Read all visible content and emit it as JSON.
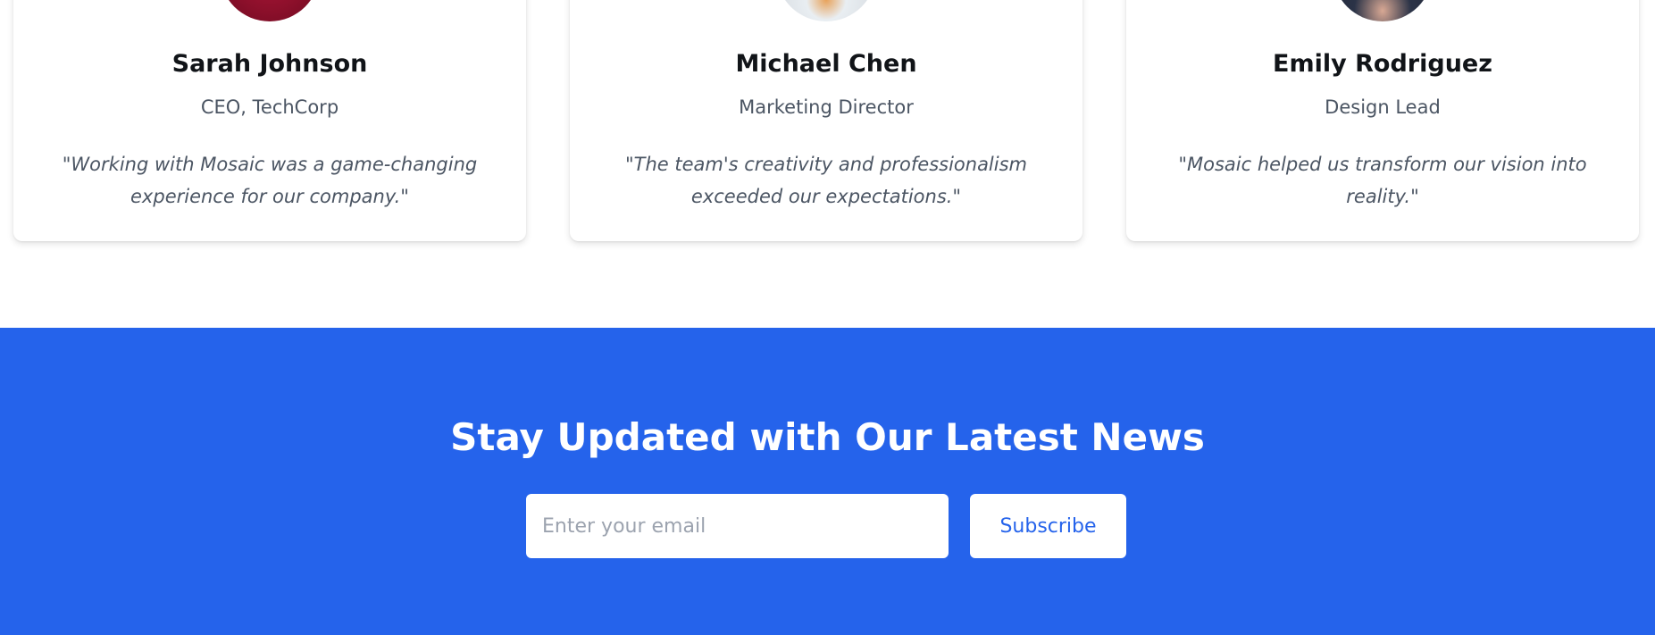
{
  "testimonials": [
    {
      "name": "Sarah Johnson",
      "role": "CEO, TechCorp",
      "quote": "\"Working with Mosaic was a game-changing experience for our company.\""
    },
    {
      "name": "Michael Chen",
      "role": "Marketing Director",
      "quote": "\"The team's creativity and professionalism exceeded our expectations.\""
    },
    {
      "name": "Emily Rodriguez",
      "role": "Design Lead",
      "quote": "\"Mosaic helped us transform our vision into reality.\""
    }
  ],
  "newsletter": {
    "title": "Stay Updated with Our Latest News",
    "email_placeholder": "Enter your email",
    "email_value": "",
    "subscribe_label": "Subscribe",
    "background_color": "#2563eb"
  }
}
